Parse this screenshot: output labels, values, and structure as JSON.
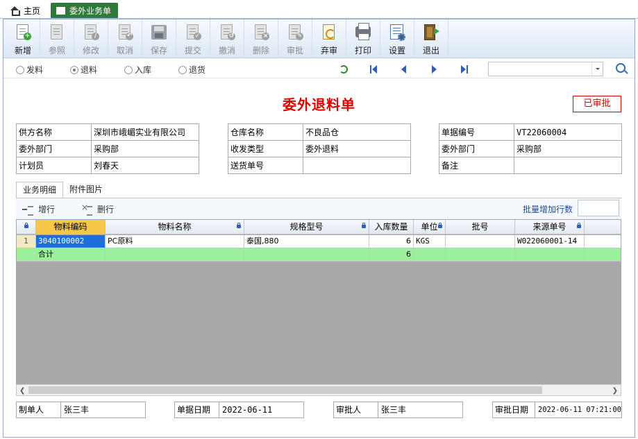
{
  "tabs": {
    "home": "主页",
    "active": "委外业务单"
  },
  "toolbar": [
    {
      "label": "新增",
      "icon": "new-icon",
      "enabled": true
    },
    {
      "label": "参照",
      "icon": "reference-icon",
      "enabled": false
    },
    {
      "label": "修改",
      "icon": "edit-icon",
      "enabled": false
    },
    {
      "label": "取消",
      "icon": "cancel-icon",
      "enabled": false
    },
    {
      "label": "保存",
      "icon": "save-icon",
      "enabled": false
    },
    {
      "label": "提交",
      "icon": "submit-icon",
      "enabled": false
    },
    {
      "label": "撤消",
      "icon": "revoke-icon",
      "enabled": false
    },
    {
      "label": "删除",
      "icon": "delete-icon",
      "enabled": false
    },
    {
      "label": "审批",
      "icon": "approve-icon",
      "enabled": false
    },
    {
      "label": "弃审",
      "icon": "unapprove-icon",
      "enabled": true
    },
    {
      "label": "打印",
      "icon": "print-icon",
      "enabled": true
    },
    {
      "label": "设置",
      "icon": "settings-icon",
      "enabled": true
    },
    {
      "label": "退出",
      "icon": "exit-icon",
      "enabled": true
    }
  ],
  "doc_types": {
    "issue": "发料",
    "return": "退料",
    "inbound": "入库",
    "goods_return": "退货",
    "selected": "退料"
  },
  "title": "委外退料单",
  "status": "已审批",
  "header": {
    "supplier_label": "供方名称",
    "supplier_value": "深圳市峨嵋实业有限公司",
    "dept_label": "委外部门",
    "dept_value": "采购部",
    "planner_label": "计划员",
    "planner_value": "刘春天",
    "warehouse_label": "仓库名称",
    "warehouse_value": "不良品仓",
    "io_type_label": "收发类型",
    "io_type_value": "委外退料",
    "delivery_no_label": "送货单号",
    "delivery_no_value": "",
    "doc_no_label": "单据编号",
    "doc_no_value": "VT22060004",
    "dept2_label": "委外部门",
    "dept2_value": "采购部",
    "remark_label": "备注",
    "remark_value": ""
  },
  "detail_tabs": {
    "items": "业务明细",
    "attachments": "附件图片"
  },
  "grid_toolbar": {
    "add_row": "增行",
    "delete_row": "删行",
    "batch_label": "批量增加行数"
  },
  "grid": {
    "columns": [
      "物料编码",
      "物料名称",
      "规格型号",
      "入库数量",
      "单位",
      "批号",
      "来源单号"
    ],
    "rows": [
      {
        "no": "1",
        "code": "3040100002",
        "name": "PC原料",
        "spec": "泰国,880",
        "qty": "6",
        "unit": "KGS",
        "batch": "",
        "source": "W022060001-14"
      }
    ],
    "total_label": "合计",
    "total_qty": "6"
  },
  "footer": {
    "maker_label": "制单人",
    "maker_value": "张三丰",
    "date_label": "单据日期",
    "date_value": "2022-06-11",
    "approver_label": "审批人",
    "approver_value": "张三丰",
    "approve_date_label": "审批日期",
    "approve_date_value": "2022-06-11 07:21:00"
  }
}
